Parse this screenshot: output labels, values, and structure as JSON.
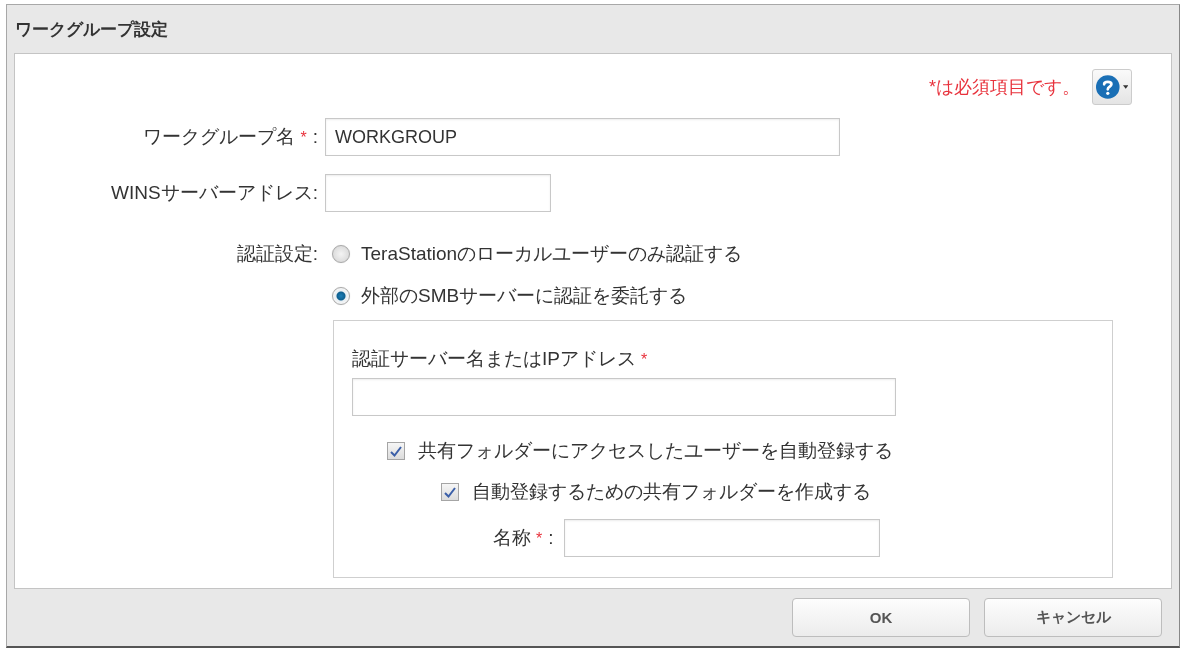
{
  "window": {
    "title": "ワークグループ設定"
  },
  "required_note": "*は必須項目です。",
  "fields": [
    {
      "label": "ワークグループ名",
      "required_mark": "*",
      "colon": ":",
      "value": "WORKGROUP"
    },
    {
      "label": "WINSサーバーアドレス",
      "colon": ":"
    }
  ],
  "auth": {
    "label": "認証設定",
    "colon": ":",
    "options": [
      {
        "label": "TeraStationのローカルユーザーのみ認証する",
        "selected": false
      },
      {
        "label": "外部のSMBサーバーに認証を委託する",
        "selected": true
      }
    ],
    "smb_panel": {
      "server_label": "認証サーバー名またはIPアドレス",
      "required_mark": "*",
      "checkboxes": [
        {
          "label": "共有フォルダーにアクセスしたユーザーを自動登録する",
          "checked": true,
          "children": [
            {
              "label": "自動登録するための共有フォルダーを作成する",
              "checked": true,
              "field": {
                "label": "名称",
                "required_mark": "*",
                "colon": ":"
              }
            }
          ]
        }
      ]
    }
  },
  "buttons": [
    {
      "label": "OK"
    },
    {
      "label": "キャンセル"
    }
  ]
}
